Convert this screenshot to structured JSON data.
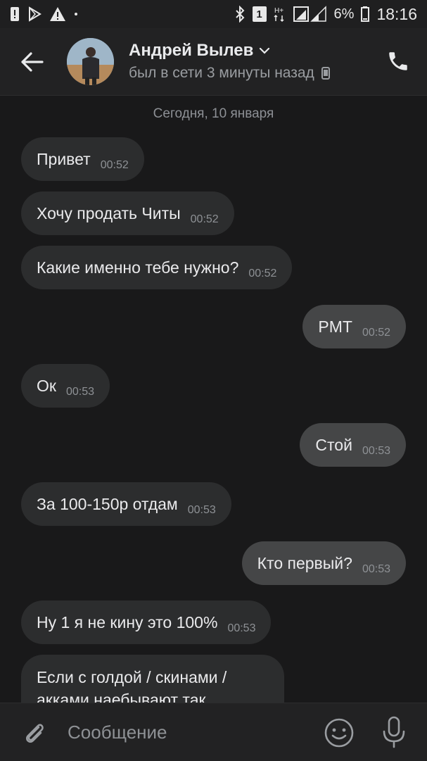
{
  "status_bar": {
    "time": "18:16",
    "battery": "6%",
    "sim": "1",
    "icons": [
      "alert-icon",
      "play-store-icon",
      "warning-icon",
      "dot-icon",
      "bluetooth-icon",
      "sim-icon",
      "hplus-icon",
      "signal-icon",
      "battery-icon"
    ]
  },
  "header": {
    "name": "Андрей Вылев",
    "status": "был в сети 3 минуты назад",
    "icons": [
      "back-arrow-icon",
      "chevron-down-icon",
      "mobile-icon",
      "phone-icon"
    ]
  },
  "chat": {
    "date": "Сегодня, 10 января",
    "messages": [
      {
        "dir": "in",
        "text": "Привет",
        "time": "00:52"
      },
      {
        "dir": "in",
        "text": "Хочу продать Читы",
        "time": "00:52"
      },
      {
        "dir": "in",
        "text": "Какие именно тебе нужно?",
        "time": "00:52"
      },
      {
        "dir": "out",
        "text": "PMT",
        "time": "00:52"
      },
      {
        "dir": "in",
        "text": "Ок",
        "time": "00:53"
      },
      {
        "dir": "out",
        "text": "Стой",
        "time": "00:53"
      },
      {
        "dir": "in",
        "text": "За 100-150р отдам",
        "time": "00:53"
      },
      {
        "dir": "out",
        "text": "Кто первый?",
        "time": "00:53"
      },
      {
        "dir": "in",
        "text": "Ну 1 я не кину это 100%",
        "time": "00:53"
      },
      {
        "dir": "in",
        "text": "Если с голдой / скинами / акками наебывают так",
        "time": ""
      }
    ]
  },
  "composer": {
    "placeholder": "Сообщение",
    "icons": [
      "attach-icon",
      "emoji-icon",
      "mic-icon"
    ]
  },
  "colors": {
    "background": "#19191a",
    "incoming_bubble": "#2c2d2e",
    "outgoing_bubble": "#454647",
    "header": "#222223"
  }
}
